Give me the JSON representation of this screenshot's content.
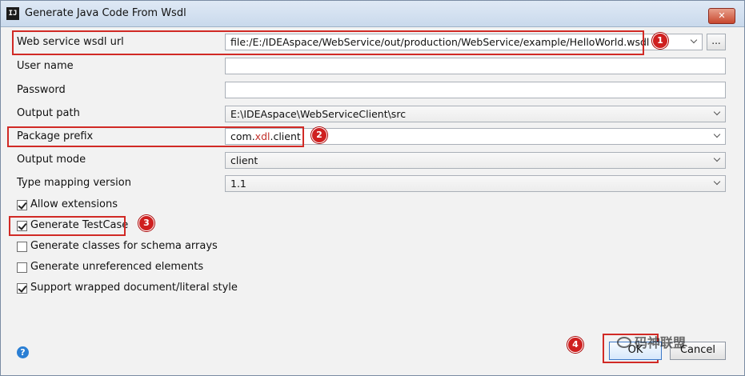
{
  "window": {
    "title": "Generate Java Code From Wsdl",
    "app_icon": "IJ",
    "close_glyph": "✕"
  },
  "form": {
    "wsdl_url": {
      "label": "Web service wsdl url",
      "value": "file:/E:/IDEAspace/WebService/out/production/WebService/example/HelloWorld.wsdl",
      "browse_label": "..."
    },
    "user_name": {
      "label": "User name",
      "value": ""
    },
    "password": {
      "label": "Password",
      "value": ""
    },
    "output_path": {
      "label": "Output path",
      "value": "E:\\IDEAspace\\WebServiceClient\\src"
    },
    "package_prefix": {
      "label": "Package prefix",
      "value_part1": "com.",
      "value_part2": "xdl",
      "value_part3": ".client"
    },
    "output_mode": {
      "label": "Output mode",
      "value": "client"
    },
    "type_mapping_version": {
      "label": "Type mapping version",
      "value": "1.1"
    }
  },
  "options": [
    {
      "label": "Allow extensions",
      "checked": true
    },
    {
      "label": "Generate TestCase",
      "checked": true
    },
    {
      "label": "Generate classes for schema arrays",
      "checked": false
    },
    {
      "label": "Generate unreferenced elements",
      "checked": false
    },
    {
      "label": "Support wrapped document/literal style",
      "checked": true
    }
  ],
  "annotations": [
    "1",
    "2",
    "3",
    "4"
  ],
  "footer": {
    "help_glyph": "?",
    "ok_label": "OK",
    "cancel_label": "Cancel"
  },
  "watermark": {
    "text": "码神联盟",
    "icon": "wechat-icon"
  },
  "colors": {
    "highlight": "#d12a25",
    "badge": "#cf1f1f",
    "accent_text": "#c2302a",
    "help": "#2b7fd4"
  }
}
